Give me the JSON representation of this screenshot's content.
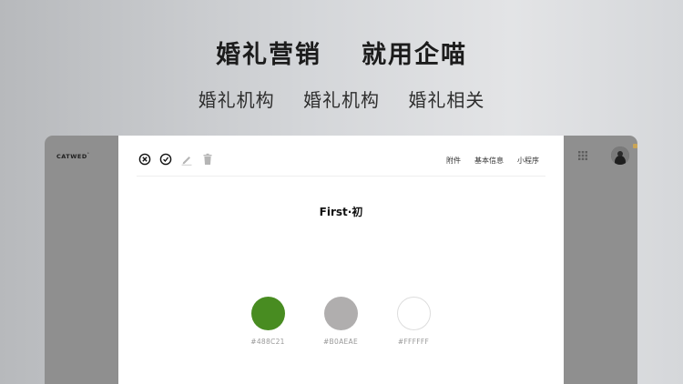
{
  "banner": {
    "headline_left": "婚礼营销",
    "headline_right": "就用企喵",
    "sub_items": [
      "婚礼机构",
      "婚礼机构",
      "婚礼相关"
    ]
  },
  "app": {
    "brand": "CATWED",
    "brand_mark": "°",
    "tabs": [
      "附件",
      "基本信息",
      "小程序"
    ],
    "title": "First·初",
    "swatches": [
      {
        "color": "#488C21",
        "label": "#488C21"
      },
      {
        "color": "#B0AEAE",
        "label": "#B0AEAE"
      },
      {
        "color": "#FFFFFF",
        "label": "#FFFFFF"
      }
    ]
  }
}
